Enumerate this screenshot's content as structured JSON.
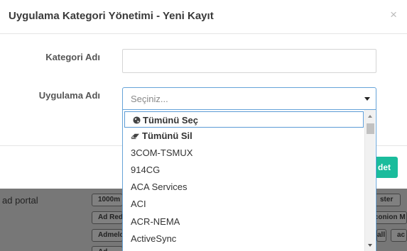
{
  "modal": {
    "title": "Uygulama Kategori Yönetimi - Yeni Kayıt",
    "close_glyph": "×",
    "fields": {
      "category_name_label": "Kategori Adı",
      "category_name_value": "",
      "application_name_label": "Uygulama Adı",
      "application_select_placeholder": "Seçiniz..."
    },
    "footer": {
      "save_label": "det"
    }
  },
  "dropdown": {
    "items": [
      {
        "label": "Tümünü Seç",
        "icon": "globe-icon",
        "bold": true,
        "highlighted": true
      },
      {
        "label": "Tümünü Sil",
        "icon": "eraser-icon",
        "bold": true,
        "highlighted": false
      },
      {
        "label": "3COM-TSMUX"
      },
      {
        "label": "914CG"
      },
      {
        "label": "ACA Services"
      },
      {
        "label": "ACI"
      },
      {
        "label": "ACR-NEMA"
      },
      {
        "label": "ActiveSync"
      }
    ]
  },
  "background_page": {
    "label": "ad portal",
    "tags": [
      "1000m",
      "Ad Red",
      "Admeld",
      "ster",
      "Iconion M",
      "all",
      "ac",
      "Ad"
    ]
  },
  "colors": {
    "accent_green": "#1abc9c",
    "focus_blue": "#66a3d8",
    "overlay_gray": "#777777"
  }
}
